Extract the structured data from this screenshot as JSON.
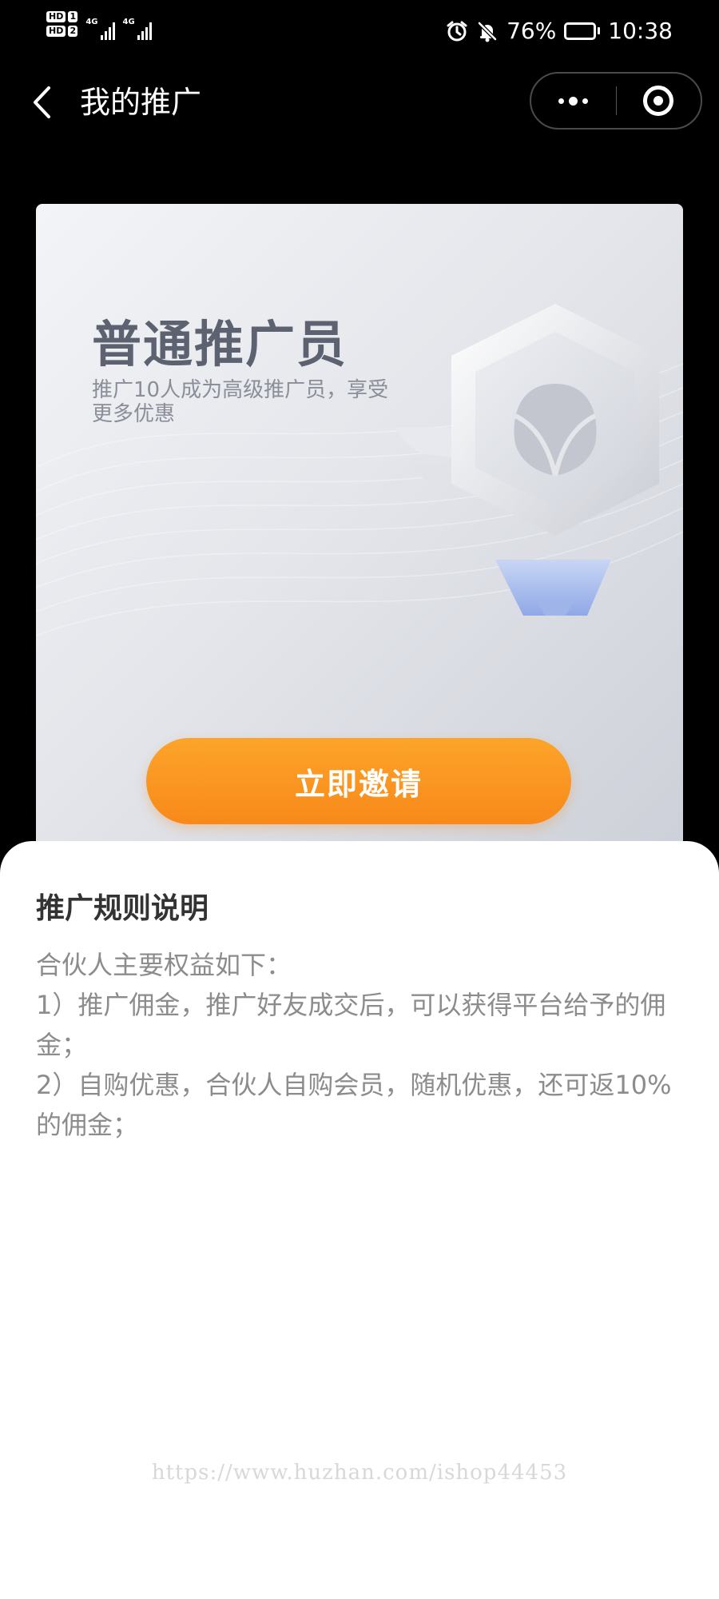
{
  "status_bar": {
    "sim1": "HD",
    "sim1_num": "1",
    "sim2": "HD",
    "sim2_num": "2",
    "network1": "4G",
    "network2": "4G",
    "battery_percent": "76%",
    "battery_level": 0.76,
    "time": "10:38",
    "icons": [
      "alarm-icon",
      "mute-bell-icon",
      "battery-icon",
      "signal-icon"
    ]
  },
  "nav": {
    "title": "我的推广",
    "icons": [
      "back-icon",
      "more-icon",
      "target-icon"
    ]
  },
  "card": {
    "title": "普通推广员",
    "subtitle": "推广10人成为高级推广员，享受更多优惠",
    "button_label": "立即邀请",
    "colors": {
      "button": "#f8891a",
      "title": "#5d6270"
    }
  },
  "rules": {
    "title": "推广规则说明",
    "intro": "合伙人主要权益如下：",
    "items": [
      "1）推广佣金，推广好友成交后，可以获得平台给予的佣金；",
      "2）自购优惠，合伙人自购会员，随机优惠，还可返10%的佣金；"
    ]
  },
  "watermark": "https://www.huzhan.com/ishop44453"
}
